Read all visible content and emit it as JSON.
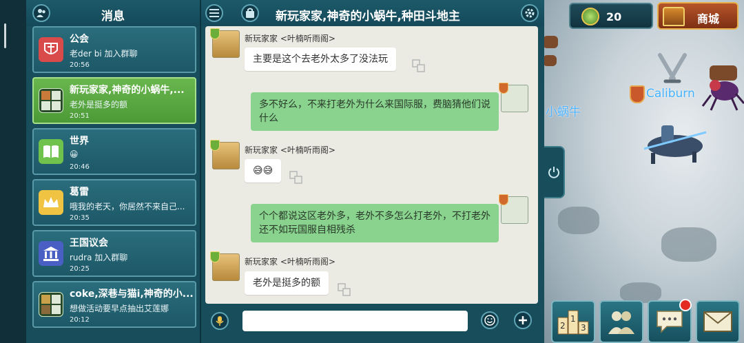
{
  "left_panel": {
    "title": "消息",
    "conversations": [
      {
        "name": "公会",
        "last_message": "老der bi 加入群聊",
        "time": "20:56",
        "icon": "guild-icon",
        "color": "#d94b4b"
      },
      {
        "name": "新玩家家,神奇的小蜗牛,...",
        "last_message": "老外是挺多的额",
        "time": "20:51",
        "icon": "group-avatar-icon",
        "color": "#2a4b2a",
        "active": true
      },
      {
        "name": "世界",
        "last_message": "😀",
        "time": "20:46",
        "icon": "world-book-icon",
        "color": "#6fc24b"
      },
      {
        "name": "葛雷",
        "last_message": "哦我的老天，你居然不来自己...",
        "time": "20:35",
        "icon": "crown-icon",
        "color": "#f1c342"
      },
      {
        "name": "王国议会",
        "last_message": "rudra 加入群聊",
        "time": "20:25",
        "icon": "council-icon",
        "color": "#4a5fc4"
      },
      {
        "name": "coke,深巷与猫i,神奇的小...",
        "last_message": "想做活动要早点抽出艾莲娜",
        "time": "20:12",
        "icon": "group-avatar-icon",
        "color": "#2a4b2a"
      }
    ]
  },
  "chat": {
    "title": "新玩家家,神奇的小蜗牛,种田斗地主",
    "messages": [
      {
        "direction": "in",
        "sender": "新玩家家 <叶楠听雨阁>",
        "text": "主要是这个去老外太多了没法玩"
      },
      {
        "direction": "out",
        "text": "多不好么，不来打老外为什么来国际服，费脑猜他们说什么"
      },
      {
        "direction": "in",
        "sender": "新玩家家 <叶楠听雨阁>",
        "text": "😅😅"
      },
      {
        "direction": "out",
        "text": "个个都说这区老外多，老外不多怎么打老外，不打老外还不如玩国服自相残杀"
      },
      {
        "direction": "in",
        "sender": "新玩家家 <叶楠听雨阁>",
        "text": "老外是挺多的额"
      }
    ],
    "input": {
      "value": "",
      "placeholder": ""
    }
  },
  "hud": {
    "gold": "20",
    "shop_label": "商城",
    "map_text_snail": "小蜗牛",
    "map_text_caliburn": "Caliburn"
  },
  "colors": {
    "panel_bg": "#184e5c",
    "chat_bg": "#ecebe3",
    "bubble_out": "#89d38e",
    "active_item": "#5aa843",
    "notify": "#e32b24"
  }
}
